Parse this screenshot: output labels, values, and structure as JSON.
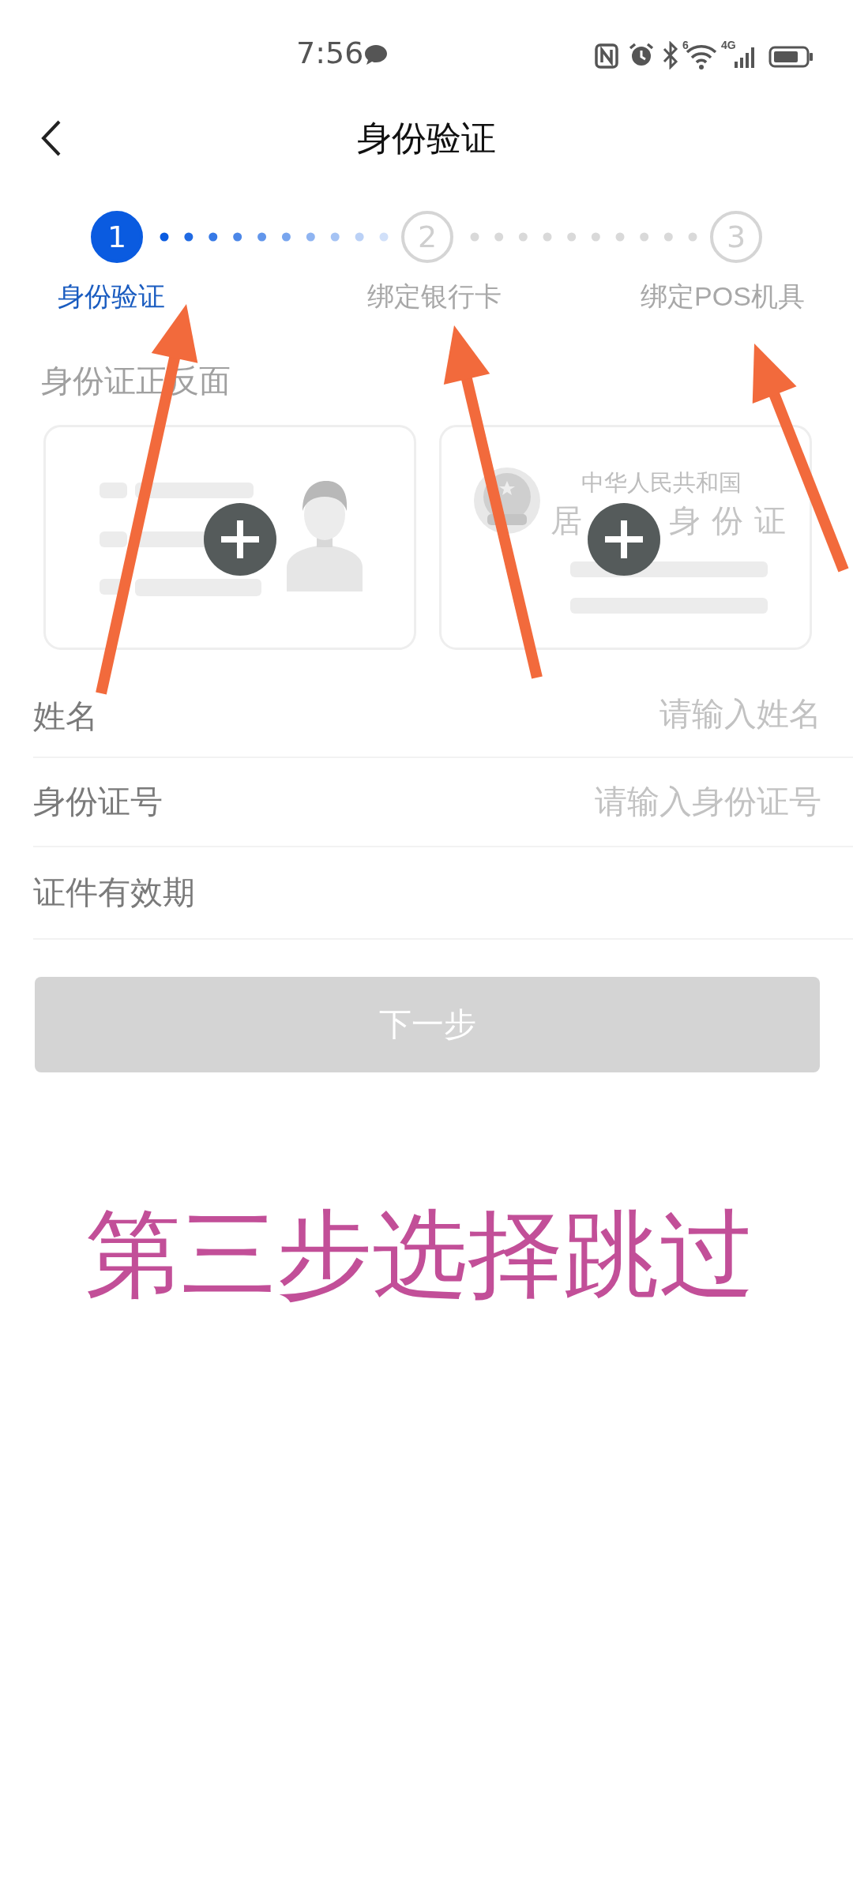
{
  "status_bar": {
    "time": "7:56",
    "wifi_badge": "6",
    "signal_badge": "4G"
  },
  "header": {
    "title": "身份验证"
  },
  "steps": [
    {
      "number": "1",
      "label": "身份验证",
      "selected": true
    },
    {
      "number": "2",
      "label": "绑定银行卡",
      "selected": false
    },
    {
      "number": "3",
      "label": "绑定POS机具",
      "selected": false
    }
  ],
  "id_section": {
    "title": "身份证正反面",
    "back_card": {
      "line_1": "中华人民共和国",
      "line_2_left": "居",
      "line_2_right": "身份证"
    }
  },
  "fields": [
    {
      "kind": "text",
      "label": "姓名",
      "placeholder": "请输入姓名"
    },
    {
      "kind": "text",
      "label": "身份证号",
      "placeholder": "请输入身份证号"
    },
    {
      "kind": "picker",
      "label": "证件有效期"
    }
  ],
  "next_button": {
    "label": "下一步",
    "disabled": true
  },
  "annotation": {
    "text": "第三步选择跳过"
  }
}
